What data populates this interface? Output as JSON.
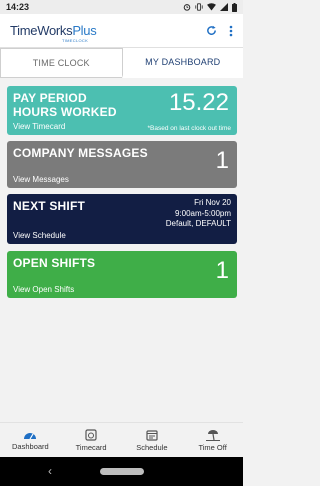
{
  "status_bar": {
    "time": "14:23"
  },
  "header": {
    "logo_main": "TimeWorks",
    "logo_plus": "Plus",
    "logo_sub": "TIMECLOCK"
  },
  "tabs": {
    "time_clock": "TIME CLOCK",
    "dashboard": "MY DASHBOARD"
  },
  "cards": {
    "pay_period": {
      "title": "PAY PERIOD HOURS WORKED",
      "value": "15.22",
      "link": "View Timecard",
      "note": "*Based on last clock out time",
      "color": "#4cbfb1"
    },
    "messages": {
      "title": "COMPANY MESSAGES",
      "value": "1",
      "link": "View Messages",
      "color": "#7b7b7b"
    },
    "next_shift": {
      "title": "NEXT SHIFT",
      "date": "Fri Nov 20",
      "time": "9:00am-5:00pm",
      "location": "Default, DEFAULT",
      "link": "View Schedule",
      "color": "#121e44"
    },
    "open_shifts": {
      "title": "OPEN SHIFTS",
      "value": "1",
      "link": "View Open Shifts",
      "color": "#3fae48"
    }
  },
  "bottom_nav": {
    "dashboard": "Dashboard",
    "timecard": "Timecard",
    "schedule": "Schedule",
    "time_off": "Time Off"
  },
  "icons": [
    "alarm-icon",
    "vibrate-icon",
    "wifi-icon",
    "signal-icon",
    "battery-icon",
    "refresh-icon",
    "more-vert-icon",
    "gauge-icon",
    "timecard-icon",
    "calendar-icon",
    "beach-icon"
  ]
}
